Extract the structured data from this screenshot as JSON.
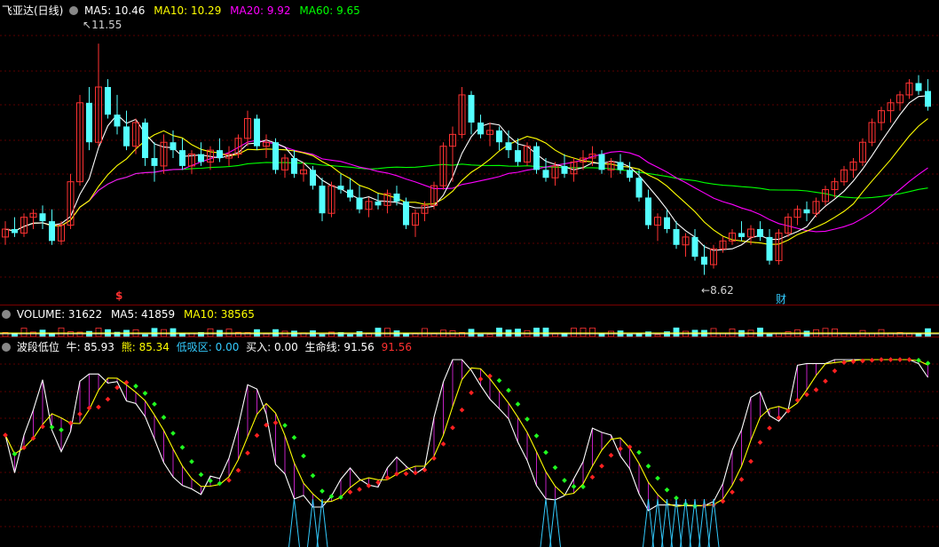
{
  "colors": {
    "bg": "#000000",
    "grid": "#5a0000",
    "up": "#ff3232",
    "down": "#54ffff",
    "ma5": "#ffffff",
    "ma10": "#ffff00",
    "ma20": "#ff00ff",
    "ma60": "#00ff00",
    "text_white": "#ffffff",
    "text_red": "#ff3030",
    "cyan": "#33ccff",
    "signal_red": "#ff2020",
    "signal_green": "#20ff20"
  },
  "price_panel": {
    "title": "飞亚达(日线)",
    "legend": [
      {
        "key": "ma5",
        "label": "MA5: 10.46",
        "color": "#ffffff"
      },
      {
        "key": "ma10",
        "label": "MA10: 10.29",
        "color": "#ffff00"
      },
      {
        "key": "ma20",
        "label": "MA20: 9.92",
        "color": "#ff00ff"
      },
      {
        "key": "ma60",
        "label": "MA60: 9.65",
        "color": "#00ff00"
      }
    ],
    "high_marker": "11.55",
    "low_marker": "8.62",
    "dividend_marker": "$",
    "finance_marker": "财"
  },
  "volume_panel": {
    "title": "VOLUME: 31622",
    "ma5": "MA5: 41859",
    "ma10": "MA10: 38565"
  },
  "indicator_panel": {
    "title": "波段低位",
    "bull": "牛: 85.93",
    "bear": "熊: 85.34",
    "low_zone": "低吸区: 0.00",
    "buy": "买入: 0.00",
    "lifeline": "生命线: 91.56",
    "lifeline2": "91.56"
  },
  "chart_data": [
    {
      "type": "candlestick",
      "title": "飞亚达(日线)",
      "xlabel": "",
      "ylabel": "",
      "ylim": [
        8.3,
        11.9
      ],
      "annotations": [
        {
          "text": "11.55",
          "type": "high"
        },
        {
          "text": "8.62",
          "type": "low"
        }
      ],
      "ma_last": {
        "MA5": 10.46,
        "MA10": 10.29,
        "MA20": 9.92,
        "MA60": 9.65
      },
      "ohlc": [
        [
          9.1,
          9.3,
          9.0,
          9.2
        ],
        [
          9.2,
          9.35,
          9.1,
          9.15
        ],
        [
          9.15,
          9.4,
          9.1,
          9.35
        ],
        [
          9.35,
          9.45,
          9.2,
          9.4
        ],
        [
          9.4,
          9.5,
          9.2,
          9.3
        ],
        [
          9.3,
          9.45,
          9.0,
          9.05
        ],
        [
          9.05,
          9.3,
          9.0,
          9.25
        ],
        [
          9.25,
          9.9,
          9.2,
          9.8
        ],
        [
          9.8,
          10.9,
          9.75,
          10.8
        ],
        [
          10.8,
          11.0,
          10.2,
          10.3
        ],
        [
          10.3,
          11.55,
          10.25,
          11.0
        ],
        [
          11.0,
          11.1,
          10.6,
          10.65
        ],
        [
          10.65,
          10.9,
          10.4,
          10.5
        ],
        [
          10.5,
          10.7,
          10.2,
          10.25
        ],
        [
          10.25,
          10.6,
          10.15,
          10.55
        ],
        [
          10.55,
          10.6,
          10.0,
          10.1
        ],
        [
          10.1,
          10.3,
          9.8,
          10.0
        ],
        [
          10.0,
          10.4,
          9.9,
          10.3
        ],
        [
          10.3,
          10.45,
          10.1,
          10.2
        ],
        [
          10.2,
          10.35,
          9.95,
          10.0
        ],
        [
          10.0,
          10.2,
          9.9,
          10.15
        ],
        [
          10.15,
          10.3,
          10.0,
          10.05
        ],
        [
          10.05,
          10.25,
          9.95,
          10.2
        ],
        [
          10.2,
          10.35,
          10.05,
          10.1
        ],
        [
          10.1,
          10.25,
          10.0,
          10.15
        ],
        [
          10.15,
          10.4,
          10.1,
          10.35
        ],
        [
          10.35,
          10.7,
          10.25,
          10.6
        ],
        [
          10.6,
          10.65,
          10.2,
          10.25
        ],
        [
          10.25,
          10.4,
          10.1,
          10.3
        ],
        [
          10.3,
          10.35,
          9.9,
          9.95
        ],
        [
          9.95,
          10.15,
          9.85,
          10.1
        ],
        [
          10.1,
          10.2,
          9.85,
          9.9
        ],
        [
          9.9,
          10.05,
          9.8,
          9.95
        ],
        [
          9.95,
          10.0,
          9.7,
          9.75
        ],
        [
          9.75,
          9.85,
          9.3,
          9.4
        ],
        [
          9.4,
          9.8,
          9.35,
          9.75
        ],
        [
          9.75,
          9.9,
          9.65,
          9.7
        ],
        [
          9.7,
          9.85,
          9.55,
          9.6
        ],
        [
          9.6,
          9.75,
          9.4,
          9.45
        ],
        [
          9.45,
          9.6,
          9.35,
          9.55
        ],
        [
          9.55,
          9.65,
          9.45,
          9.5
        ],
        [
          9.5,
          9.7,
          9.4,
          9.65
        ],
        [
          9.65,
          9.75,
          9.5,
          9.55
        ],
        [
          9.55,
          9.6,
          9.2,
          9.25
        ],
        [
          9.25,
          9.45,
          9.1,
          9.4
        ],
        [
          9.4,
          9.55,
          9.3,
          9.5
        ],
        [
          9.5,
          9.8,
          9.45,
          9.75
        ],
        [
          9.75,
          10.3,
          9.7,
          10.25
        ],
        [
          10.25,
          10.5,
          9.8,
          10.4
        ],
        [
          10.4,
          11.0,
          10.35,
          10.9
        ],
        [
          10.9,
          10.95,
          10.4,
          10.55
        ],
        [
          10.55,
          10.65,
          10.35,
          10.4
        ],
        [
          10.4,
          10.55,
          10.25,
          10.45
        ],
        [
          10.45,
          10.5,
          10.2,
          10.3
        ],
        [
          10.3,
          10.45,
          10.1,
          10.2
        ],
        [
          10.2,
          10.35,
          10.0,
          10.05
        ],
        [
          10.05,
          10.3,
          10.0,
          10.25
        ],
        [
          10.25,
          10.3,
          9.9,
          9.95
        ],
        [
          9.95,
          10.1,
          9.8,
          9.85
        ],
        [
          9.85,
          10.05,
          9.75,
          10.0
        ],
        [
          10.0,
          10.15,
          9.85,
          9.9
        ],
        [
          9.9,
          10.1,
          9.8,
          10.05
        ],
        [
          10.05,
          10.2,
          9.95,
          10.1
        ],
        [
          10.1,
          10.25,
          10.0,
          10.15
        ],
        [
          10.15,
          10.2,
          9.9,
          9.95
        ],
        [
          9.95,
          10.1,
          9.85,
          10.05
        ],
        [
          10.05,
          10.15,
          9.9,
          9.95
        ],
        [
          9.95,
          10.05,
          9.8,
          9.85
        ],
        [
          9.85,
          9.95,
          9.55,
          9.6
        ],
        [
          9.6,
          9.7,
          9.2,
          9.25
        ],
        [
          9.25,
          9.4,
          9.05,
          9.35
        ],
        [
          9.35,
          9.45,
          9.15,
          9.2
        ],
        [
          9.2,
          9.3,
          8.95,
          9.0
        ],
        [
          9.0,
          9.15,
          8.85,
          9.1
        ],
        [
          9.1,
          9.2,
          8.8,
          8.85
        ],
        [
          8.85,
          9.0,
          8.62,
          8.75
        ],
        [
          8.75,
          9.0,
          8.7,
          8.95
        ],
        [
          8.95,
          9.1,
          8.9,
          9.05
        ],
        [
          9.05,
          9.2,
          9.0,
          9.15
        ],
        [
          9.15,
          9.3,
          9.05,
          9.1
        ],
        [
          9.1,
          9.25,
          9.0,
          9.2
        ],
        [
          9.2,
          9.3,
          9.05,
          9.1
        ],
        [
          9.1,
          9.2,
          8.75,
          8.8
        ],
        [
          8.8,
          9.2,
          8.75,
          9.15
        ],
        [
          9.15,
          9.4,
          9.1,
          9.35
        ],
        [
          9.35,
          9.5,
          9.25,
          9.45
        ],
        [
          9.45,
          9.55,
          9.3,
          9.4
        ],
        [
          9.4,
          9.6,
          9.35,
          9.55
        ],
        [
          9.55,
          9.75,
          9.5,
          9.7
        ],
        [
          9.7,
          9.85,
          9.6,
          9.8
        ],
        [
          9.8,
          10.0,
          9.75,
          9.95
        ],
        [
          9.95,
          10.1,
          9.85,
          10.05
        ],
        [
          10.05,
          10.35,
          10.0,
          10.3
        ],
        [
          10.3,
          10.6,
          10.25,
          10.55
        ],
        [
          10.55,
          10.75,
          10.45,
          10.7
        ],
        [
          10.7,
          10.85,
          10.55,
          10.8
        ],
        [
          10.8,
          10.95,
          10.7,
          10.9
        ],
        [
          10.9,
          11.1,
          10.85,
          11.05
        ],
        [
          11.05,
          11.15,
          10.9,
          10.95
        ],
        [
          10.95,
          11.1,
          10.7,
          10.75
        ]
      ]
    },
    {
      "type": "bar",
      "title": "VOLUME",
      "xlabel": "",
      "ylabel": "",
      "series": [
        {
          "name": "VOLUME",
          "values": [
            31622
          ]
        }
      ],
      "ma": {
        "MA5": 41859,
        "MA10": 38565
      }
    },
    {
      "type": "line",
      "title": "波段低位",
      "xlabel": "",
      "ylabel": "",
      "values_shown": {
        "牛": 85.93,
        "熊": 85.34,
        "低吸区": 0.0,
        "买入": 0.0,
        "生命线": 91.56
      }
    }
  ]
}
